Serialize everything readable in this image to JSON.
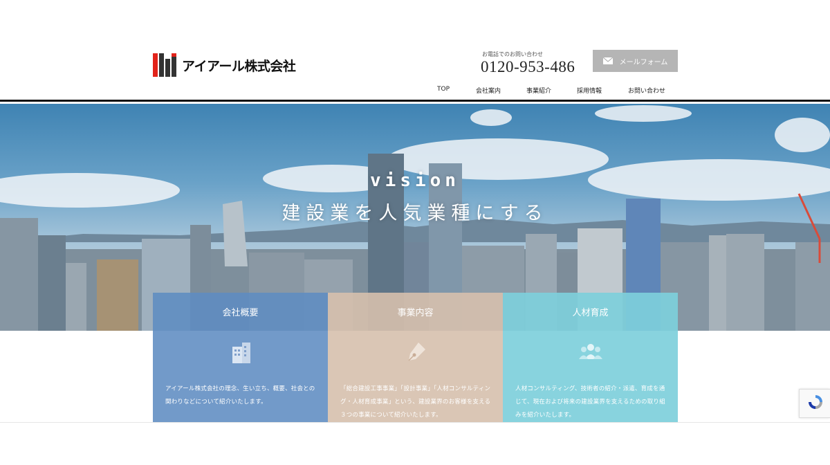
{
  "header": {
    "logo_text": "アイアール株式会社",
    "phone_caption": "お電話でのお問い合わせ",
    "phone_number": "0120-953-486",
    "mail_button_label": "メールフォーム"
  },
  "nav": {
    "items": [
      {
        "label": "TOP"
      },
      {
        "label": "会社案内"
      },
      {
        "label": "事業紹介"
      },
      {
        "label": "採用情報"
      },
      {
        "label": "お問い合わせ"
      }
    ]
  },
  "hero": {
    "title_en": "vision",
    "title_jp": "建設業を人気業種にする"
  },
  "cards": [
    {
      "title": "会社概要",
      "icon": "building-icon",
      "description": "アイアール株式会社の理念、生い立ち、概要、社会との関わりなどについて紹介いたします。",
      "color": "#5f8cc2"
    },
    {
      "title": "事業内容",
      "icon": "pen-nib-icon",
      "description": "「総合建設工事事業」「設計事業」「人材コンサルティング・人材育成事業」という、建設業界のお客様を支える３つの事業について紹介いたします。",
      "color": "#d6c0ad"
    },
    {
      "title": "人材育成",
      "icon": "people-group-icon",
      "description": "人材コンサルティング、技術者の紹介・派遣、育成を通じて、現在および将来の建設業界を支えるための取り組みを紹介いたします。",
      "color": "#7ecfdb"
    }
  ],
  "colors": {
    "header_border": "#111111",
    "mail_button": "#b5b5b5",
    "logo_red": "#e2231a",
    "logo_dark": "#333333"
  }
}
